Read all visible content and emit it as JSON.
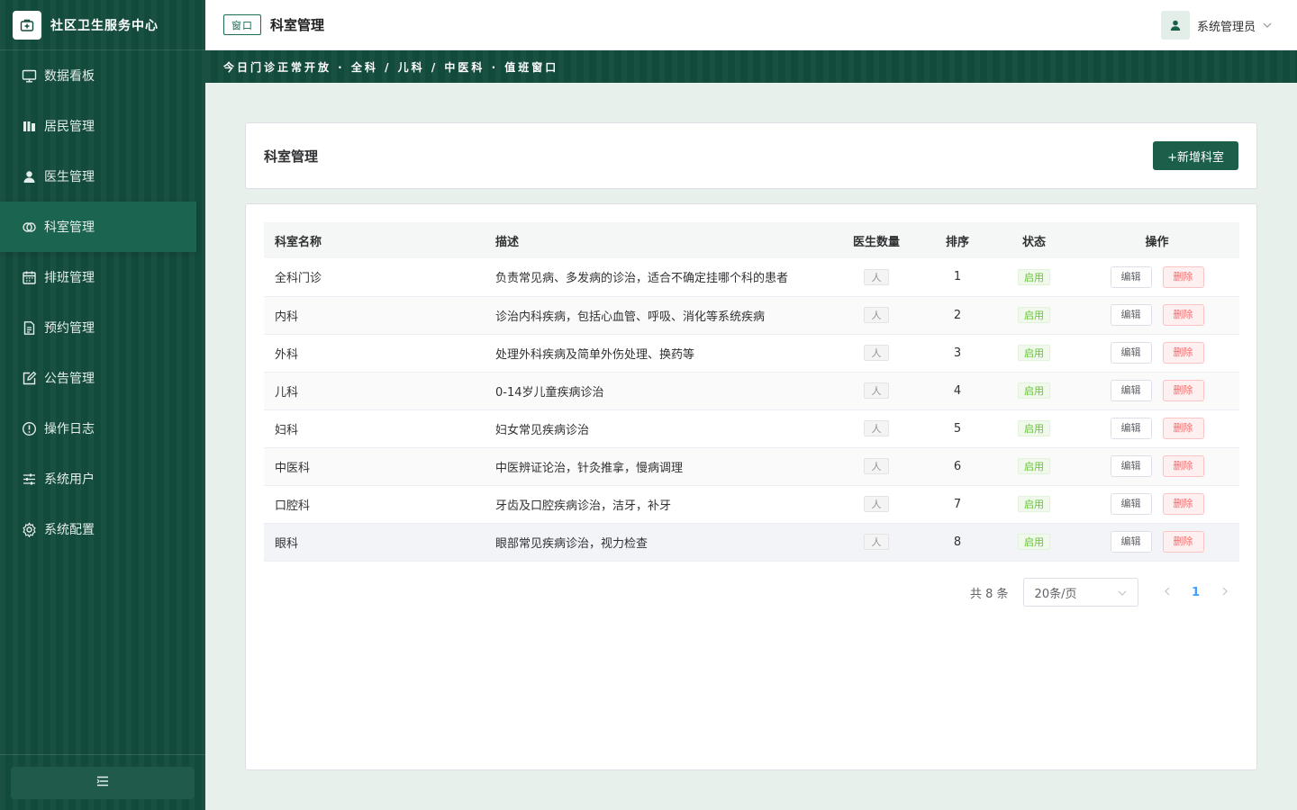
{
  "app": {
    "title": "社区卫生服务中心"
  },
  "sidebar": {
    "items": [
      {
        "label": "数据看板",
        "icon": "monitor-icon"
      },
      {
        "label": "居民管理",
        "icon": "residents-icon"
      },
      {
        "label": "医生管理",
        "icon": "user-icon"
      },
      {
        "label": "科室管理",
        "icon": "department-icon",
        "active": true
      },
      {
        "label": "排班管理",
        "icon": "calendar-icon"
      },
      {
        "label": "预约管理",
        "icon": "document-icon"
      },
      {
        "label": "公告管理",
        "icon": "edit-icon"
      },
      {
        "label": "操作日志",
        "icon": "info-icon"
      },
      {
        "label": "系统用户",
        "icon": "sliders-icon"
      },
      {
        "label": "系统配置",
        "icon": "gear-icon"
      }
    ],
    "collapse_icon": "menu-fold-icon"
  },
  "header": {
    "tag": "窗口",
    "title": "科室管理",
    "user_name": "系统管理员"
  },
  "banner": {
    "text": "今日门诊正常开放 · 全科 / 儿科 / 中医科 · 值班窗口"
  },
  "page": {
    "title": "科室管理",
    "add_button": "+新增科室"
  },
  "table": {
    "columns": [
      "科室名称",
      "描述",
      "医生数量",
      "排序",
      "状态",
      "操作"
    ],
    "doctor_badge": "人",
    "status_label": "启用",
    "edit_label": "编辑",
    "delete_label": "删除",
    "rows": [
      {
        "name": "全科门诊",
        "desc": "负责常见病、多发病的诊治，适合不确定挂哪个科的患者",
        "order": "1"
      },
      {
        "name": "内科",
        "desc": "诊治内科疾病，包括心血管、呼吸、消化等系统疾病",
        "order": "2"
      },
      {
        "name": "外科",
        "desc": "处理外科疾病及简单外伤处理、换药等",
        "order": "3"
      },
      {
        "name": "儿科",
        "desc": "0-14岁儿童疾病诊治",
        "order": "4"
      },
      {
        "name": "妇科",
        "desc": "妇女常见疾病诊治",
        "order": "5"
      },
      {
        "name": "中医科",
        "desc": "中医辨证论治，针灸推拿，慢病调理",
        "order": "6"
      },
      {
        "name": "口腔科",
        "desc": "牙齿及口腔疾病诊治，洁牙，补牙",
        "order": "7"
      },
      {
        "name": "眼科",
        "desc": "眼部常见疾病诊治，视力检查",
        "order": "8"
      }
    ]
  },
  "pagination": {
    "total": "共 8 条",
    "page_size": "20条/页",
    "current_page": "1"
  },
  "colors": {
    "brand": "#124a3b",
    "primary_button": "#1b5e4a",
    "active_menu": "#1b6550",
    "status_green": "#67c23a",
    "danger": "#f56c6c",
    "page_link": "#409eff"
  }
}
